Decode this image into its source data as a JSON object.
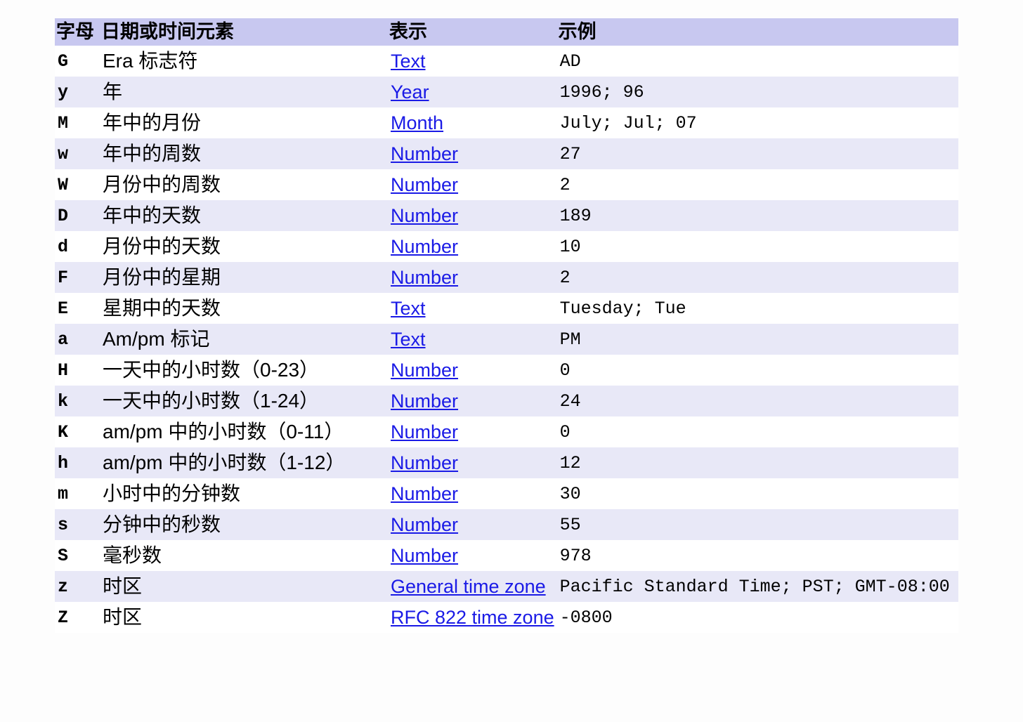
{
  "headers": {
    "letter": "字母",
    "component": "日期或时间元素",
    "presentation": "表示",
    "example": "示例"
  },
  "rows": [
    {
      "letter": "G",
      "component": "Era 标志符",
      "presentation": "Text",
      "example": "AD"
    },
    {
      "letter": "y",
      "component": "年",
      "presentation": "Year",
      "example": "1996; 96"
    },
    {
      "letter": "M",
      "component": "年中的月份",
      "presentation": "Month",
      "example": "July; Jul; 07"
    },
    {
      "letter": "w",
      "component": "年中的周数",
      "presentation": "Number",
      "example": "27"
    },
    {
      "letter": "W",
      "component": "月份中的周数",
      "presentation": "Number",
      "example": "2"
    },
    {
      "letter": "D",
      "component": "年中的天数",
      "presentation": "Number",
      "example": "189"
    },
    {
      "letter": "d",
      "component": "月份中的天数",
      "presentation": "Number",
      "example": "10"
    },
    {
      "letter": "F",
      "component": "月份中的星期",
      "presentation": "Number",
      "example": "2"
    },
    {
      "letter": "E",
      "component": "星期中的天数",
      "presentation": "Text",
      "example": "Tuesday; Tue"
    },
    {
      "letter": "a",
      "component": "Am/pm 标记",
      "presentation": "Text",
      "example": "PM"
    },
    {
      "letter": "H",
      "component": "一天中的小时数（0-23）",
      "presentation": "Number",
      "example": "0"
    },
    {
      "letter": "k",
      "component": "一天中的小时数（1-24）",
      "presentation": "Number",
      "example": "24"
    },
    {
      "letter": "K",
      "component": "am/pm 中的小时数（0-11）",
      "presentation": "Number",
      "example": "0"
    },
    {
      "letter": "h",
      "component": "am/pm 中的小时数（1-12）",
      "presentation": "Number",
      "example": "12"
    },
    {
      "letter": "m",
      "component": "小时中的分钟数",
      "presentation": "Number",
      "example": "30"
    },
    {
      "letter": "s",
      "component": "分钟中的秒数",
      "presentation": "Number",
      "example": "55"
    },
    {
      "letter": "S",
      "component": "毫秒数",
      "presentation": "Number",
      "example": "978"
    },
    {
      "letter": "z",
      "component": "时区",
      "presentation": "General time zone",
      "example": "Pacific Standard Time; PST; GMT-08:00"
    },
    {
      "letter": "Z",
      "component": "时区",
      "presentation": "RFC 822 time zone",
      "example": "-0800"
    }
  ]
}
